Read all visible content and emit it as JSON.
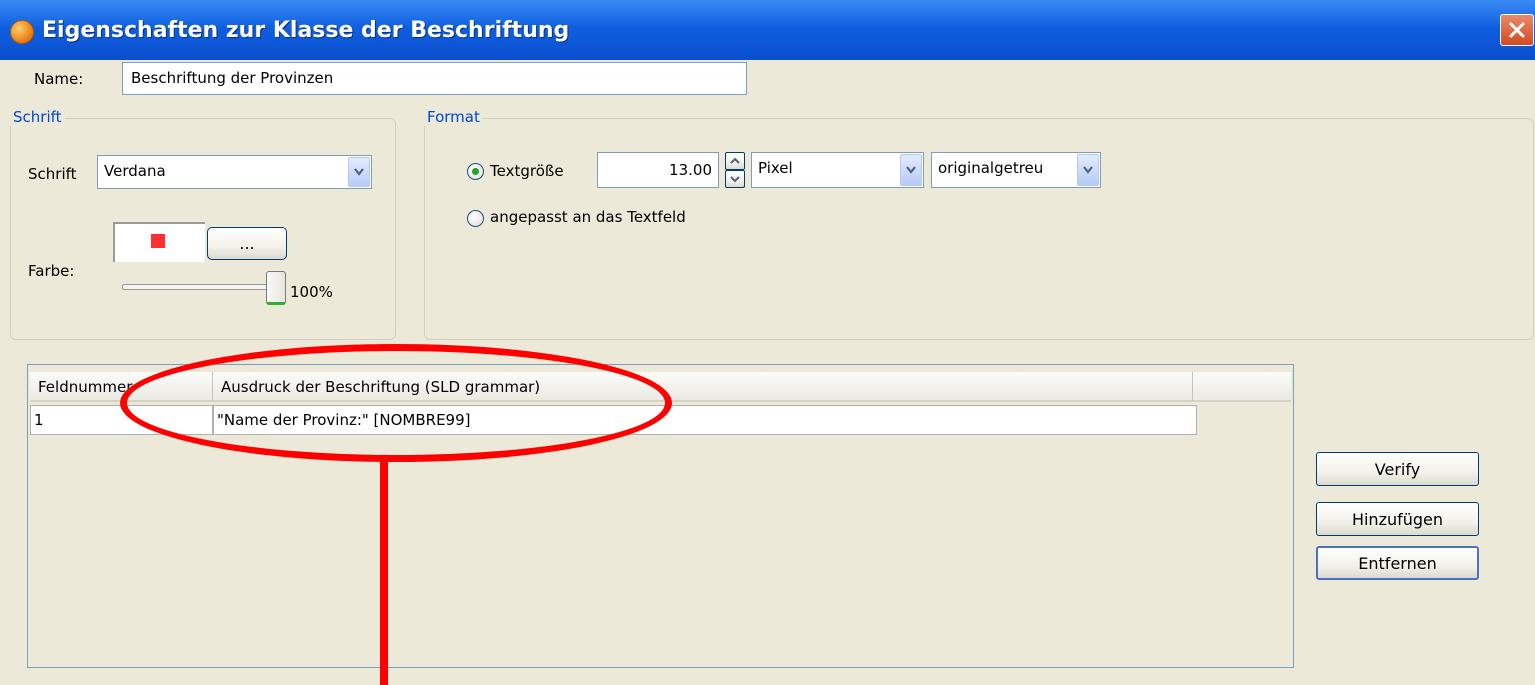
{
  "window": {
    "title": "Eigenschaften zur Klasse der Beschriftung"
  },
  "name_field": {
    "label": "Name:",
    "value": "Beschriftung der Provinzen"
  },
  "schrift_group": {
    "legend": "Schrift",
    "font_label": "Schrift",
    "font_value": "Verdana",
    "color_label": "Farbe:",
    "color_swatch": "#ff3030",
    "color_button_label": "...",
    "opacity_percent": 100,
    "opacity_label": "100%"
  },
  "format_group": {
    "legend": "Format",
    "option_textsize_label": "Textgröße",
    "option_textsize_selected": true,
    "size_value": "13.00",
    "unit_value": "Pixel",
    "mode_value": "originalgetreu",
    "option_fit_label": "angepasst an das Textfeld",
    "option_fit_selected": false
  },
  "table": {
    "columns": [
      "Feldnummer",
      "Ausdruck der Beschriftung (SLD grammar)"
    ],
    "rows": [
      {
        "field": "1",
        "expression": "\"Name der Provinz:\" [NOMBRE99]"
      }
    ]
  },
  "buttons": {
    "verify": "Verify",
    "add": "Hinzufügen",
    "remove": "Entfernen"
  },
  "colors": {
    "annotation": "#ff0000",
    "titlebar": "#0f5fe0",
    "legend_text": "#0046d5"
  }
}
